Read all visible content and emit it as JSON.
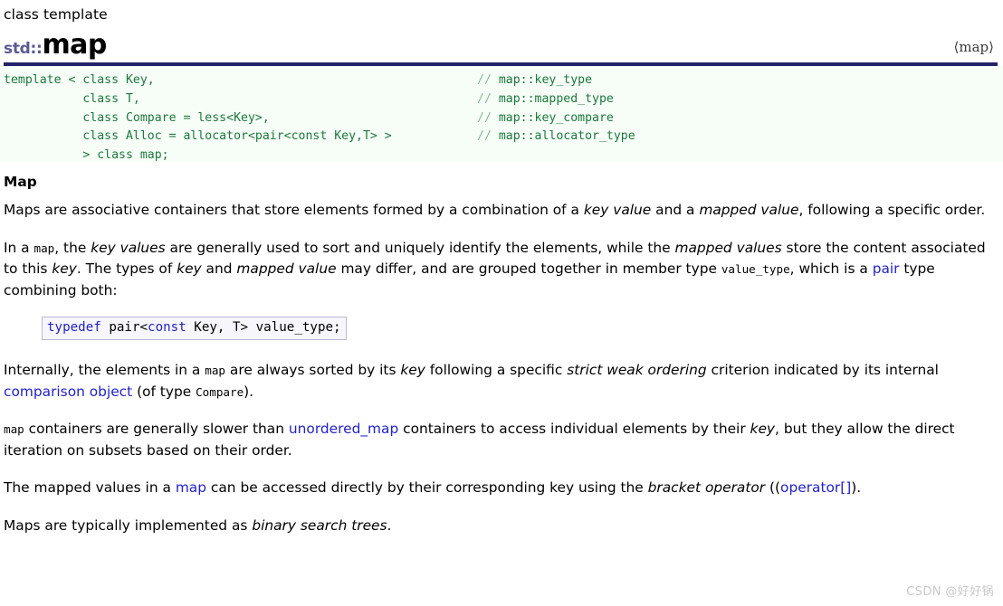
{
  "header": {
    "kicker": "class template",
    "namespace": "std::",
    "name": "map",
    "header_file": "⟨map⟩"
  },
  "declaration": {
    "left_lines": [
      "template < class Key,",
      "           class T,",
      "           class Compare = less<Key>,",
      "           class Alloc = allocator<pair<const Key,T> >",
      "           > class map;"
    ],
    "comments": [
      {
        "slash": "// ",
        "text": "map::key_type"
      },
      {
        "slash": "// ",
        "text": "map::mapped_type"
      },
      {
        "slash": "// ",
        "text": "map::key_compare"
      },
      {
        "slash": "// ",
        "text": "map::allocator_type"
      }
    ]
  },
  "body": {
    "section_title": "Map",
    "p1": {
      "a": "Maps are associative containers that store elements formed by a combination of a ",
      "em1": "key value",
      "b": " and a ",
      "em2": "mapped value",
      "c": ", following a specific order."
    },
    "p2": {
      "a": "In a ",
      "code1": "map",
      "b": ", the ",
      "em1": "key values",
      "c": " are generally used to sort and uniquely identify the elements, while the ",
      "em2": "mapped values",
      "d": " store the content associated to this ",
      "em3": "key",
      "e": ". The types of ",
      "em4": "key",
      "f": " and ",
      "em5": "mapped value",
      "g": " may differ, and are grouped together in member type ",
      "code2": "value_type",
      "h": ", which is a ",
      "link1": "pair",
      "i": " type combining both:"
    },
    "typedef": {
      "kw1": "typedef",
      "mid": " pair<",
      "kw2": "const",
      "tail": " Key, T> value_type;"
    },
    "p3": {
      "a": "Internally, the elements in a ",
      "code1": "map",
      "b": " are always sorted by its ",
      "em1": "key",
      "c": " following a specific ",
      "em2": "strict weak ordering",
      "d": " criterion indicated by its internal ",
      "link1": "comparison object",
      "e": " (of type ",
      "code2": "Compare",
      "f": ")."
    },
    "p4": {
      "code1": "map",
      "a": " containers are generally slower than ",
      "link1": "unordered_map",
      "b": " containers to access individual elements by their ",
      "em1": "key",
      "c": ", but they allow the direct iteration on subsets based on their order."
    },
    "p5": {
      "a": "The mapped values in a ",
      "link1": "map",
      "b": " can be accessed directly by their corresponding key using the ",
      "em1": "bracket operator",
      "c": " ((",
      "link2": "operator[]",
      "d": ")."
    },
    "p6": {
      "a": "Maps are typically implemented as ",
      "em1": "binary search trees",
      "b": "."
    }
  },
  "watermark": "CSDN @好好锅"
}
